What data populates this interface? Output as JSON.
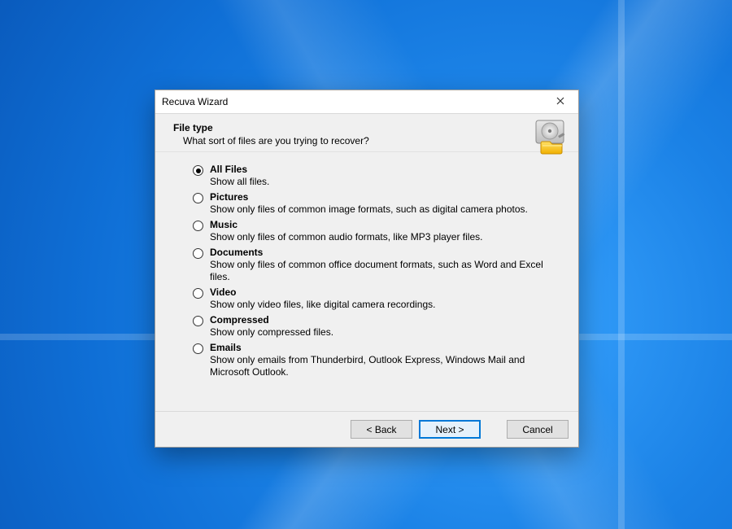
{
  "window": {
    "title": "Recuva Wizard"
  },
  "header": {
    "title": "File type",
    "subtitle": "What sort of files are you trying to recover?"
  },
  "options": {
    "selected_index": 0,
    "items": [
      {
        "label": "All Files",
        "desc": "Show all files."
      },
      {
        "label": "Pictures",
        "desc": "Show only files of common image formats, such as digital camera photos."
      },
      {
        "label": "Music",
        "desc": "Show only files of common audio formats, like MP3 player files."
      },
      {
        "label": "Documents",
        "desc": "Show only files of common office document formats, such as Word and Excel files."
      },
      {
        "label": "Video",
        "desc": "Show only video files, like digital camera recordings."
      },
      {
        "label": "Compressed",
        "desc": "Show only compressed files."
      },
      {
        "label": "Emails",
        "desc": "Show only emails from Thunderbird, Outlook Express, Windows Mail and Microsoft Outlook."
      }
    ]
  },
  "buttons": {
    "back": "< Back",
    "next": "Next >",
    "cancel": "Cancel"
  }
}
